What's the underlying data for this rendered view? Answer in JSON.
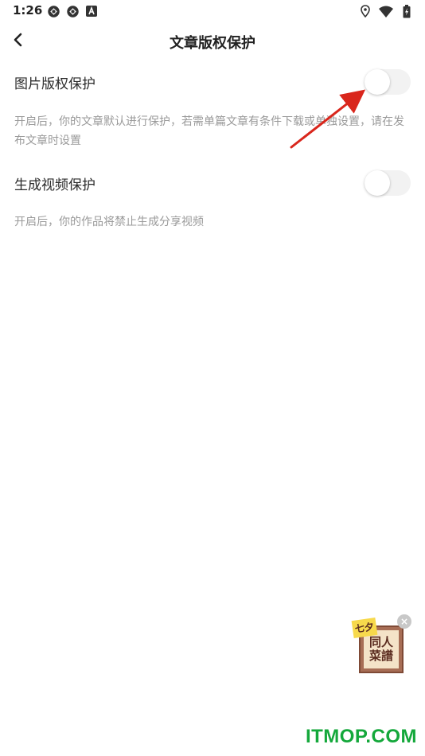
{
  "status_bar": {
    "time": "1:26",
    "left_icons": [
      "sync-icon",
      "sync-icon",
      "font-a-icon"
    ],
    "right_icons": [
      "location-icon",
      "wifi-icon",
      "battery-icon"
    ]
  },
  "header": {
    "title": "文章版权保护",
    "back_icon": "chevron-left-icon"
  },
  "settings": [
    {
      "label": "图片版权保护",
      "enabled": false,
      "description": "开启后，你的文章默认进行保护，若需单篇文章有条件下载或单独设置，请在发布文章时设置"
    },
    {
      "label": "生成视频保护",
      "enabled": false,
      "description": "开启后，你的作品将禁止生成分享视频"
    }
  ],
  "floating_ad": {
    "sticker_text": "七夕",
    "title_line1": "同人",
    "title_line2": "菜譜",
    "close_label": "×"
  },
  "watermark": "ITMOP.COM",
  "colors": {
    "arrow": "#d9261c",
    "watermark": "#14a83b",
    "toggle_off": "#f2f2f2"
  }
}
